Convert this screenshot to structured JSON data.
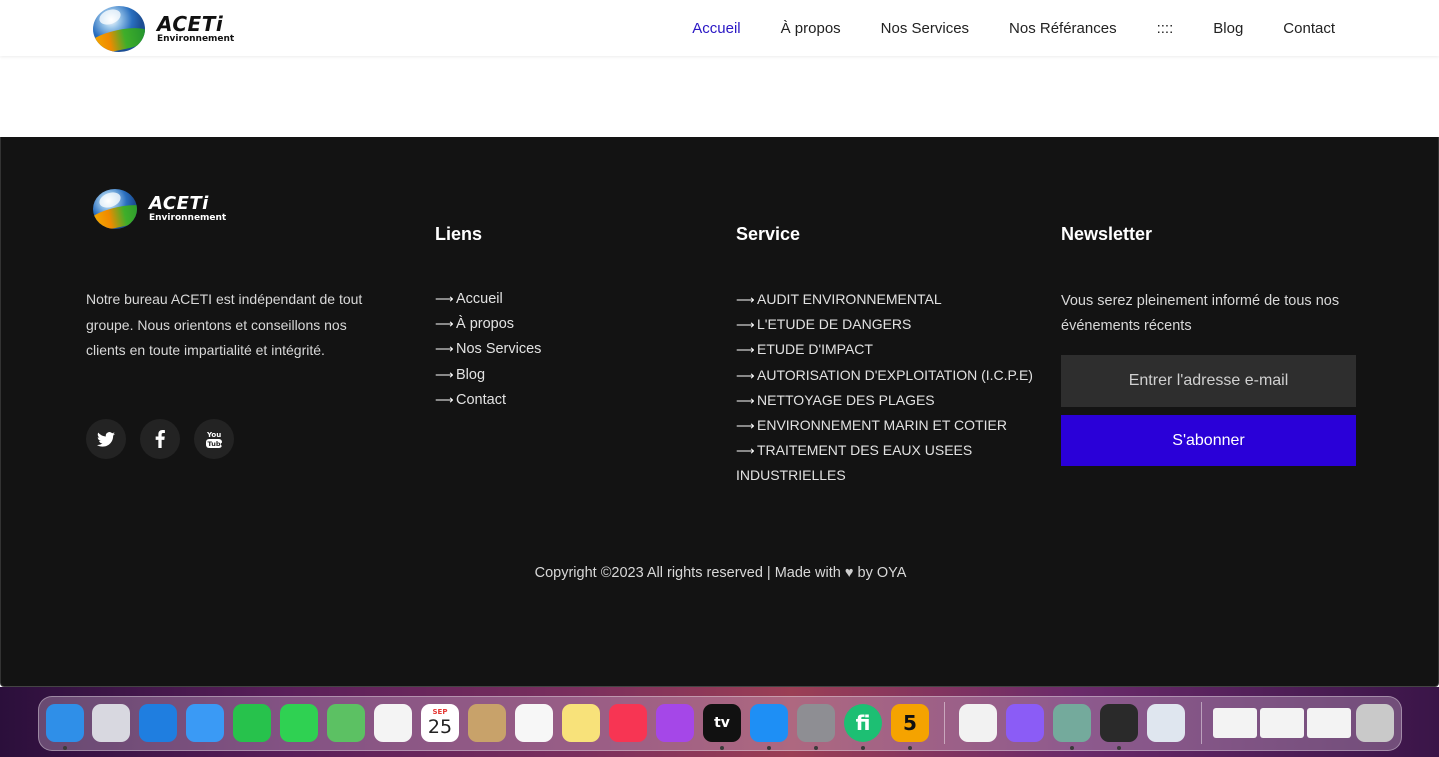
{
  "brand": {
    "name": "ACETi",
    "subtitle": "Environnement"
  },
  "nav": {
    "items": [
      {
        "label": "Accueil",
        "active": true
      },
      {
        "label": "À propos"
      },
      {
        "label": "Nos Services"
      },
      {
        "label": "Nos Référances"
      },
      {
        "label": "::::"
      },
      {
        "label": "Blog"
      },
      {
        "label": "Contact"
      }
    ],
    "active_color": "#2a17c4"
  },
  "footer": {
    "about": "Notre bureau ACETI est indépendant de tout groupe. Nous orientons et conseillons nos clients en toute impartialité et intégrité.",
    "socials": [
      "twitter-icon",
      "facebook-icon",
      "youtube-icon"
    ],
    "links": {
      "title": "Liens",
      "items": [
        "Accueil",
        "À propos",
        "Nos Services",
        "Blog",
        "Contact"
      ]
    },
    "service": {
      "title": "Service",
      "items": [
        "AUDIT ENVIRONNEMENTAL",
        "L'ETUDE DE DANGERS",
        "ETUDE D'IMPACT",
        "AUTORISATION D'EXPLOITATION (I.C.P.E)",
        "NETTOYAGE DES PLAGES",
        "ENVIRONNEMENT MARIN ET COTIER",
        "TRAITEMENT DES EAUX USEES INDUSTRIELLES"
      ]
    },
    "newsletter": {
      "title": "Newsletter",
      "text": "Vous serez pleinement informé de tous nos événements récents",
      "email_placeholder": "Entrer l'adresse e-mail",
      "subscribe_label": "S'abonner",
      "button_color": "#2a00d8"
    },
    "copyright_prefix": "Copyright ©2023 All rights reserved | Made with",
    "copyright_suffix": "by OYA"
  },
  "dock": {
    "icons": [
      {
        "name": "finder-icon",
        "color": "#2f8fe8"
      },
      {
        "name": "launchpad-icon",
        "color": "#d8d8e0"
      },
      {
        "name": "safari-icon",
        "color": "#1f7ee0"
      },
      {
        "name": "mail-icon",
        "color": "#3a9af5"
      },
      {
        "name": "facetime-icon",
        "color": "#27c24c"
      },
      {
        "name": "messages-icon",
        "color": "#2fd152"
      },
      {
        "name": "maps-icon",
        "color": "#5cc163"
      },
      {
        "name": "photos-icon",
        "color": "#f4f4f4"
      },
      {
        "name": "calendar-icon",
        "color": "#ffffff",
        "month": "SEP",
        "day": "25"
      },
      {
        "name": "contacts-icon",
        "color": "#c8a26a"
      },
      {
        "name": "reminders-icon",
        "color": "#f7f7f7"
      },
      {
        "name": "notes-icon",
        "color": "#f8e27a"
      },
      {
        "name": "music-icon",
        "color": "#f73553"
      },
      {
        "name": "podcasts-icon",
        "color": "#a547e8"
      },
      {
        "name": "appletv-icon",
        "color": "#111111",
        "label": "tv"
      },
      {
        "name": "appstore-icon",
        "color": "#1e8ff5"
      },
      {
        "name": "settings-icon",
        "color": "#8e8e93"
      },
      {
        "name": "fiverr-icon",
        "color": "#1dbf73",
        "label": "fi"
      },
      {
        "name": "five-app-icon",
        "color": "#f5a300",
        "label": "5"
      },
      {
        "name": "chrome-icon",
        "color": "#f2f2f2"
      },
      {
        "name": "messenger-icon",
        "color": "#8b5cf6"
      },
      {
        "name": "chatgpt-icon",
        "color": "#74aa9c"
      },
      {
        "name": "record-icon",
        "color": "#2a2a2a"
      },
      {
        "name": "preview-icon",
        "color": "#dfe6ef"
      },
      {
        "name": "window-thumb-1-icon",
        "color": "#f3f3f3"
      },
      {
        "name": "window-thumb-2-icon",
        "color": "#f3f3f3"
      },
      {
        "name": "window-thumb-3-icon",
        "color": "#f3f3f3"
      },
      {
        "name": "trash-icon",
        "color": "#c9c9c9"
      }
    ]
  }
}
